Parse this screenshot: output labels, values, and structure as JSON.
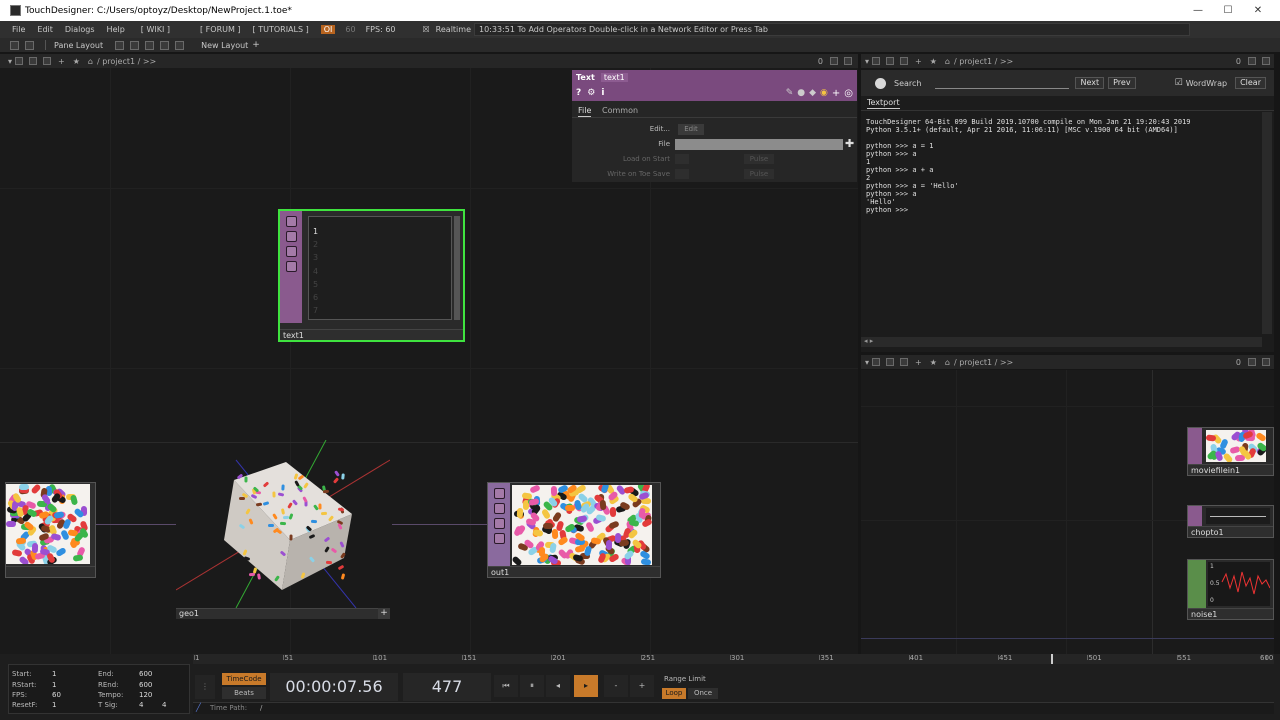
{
  "window": {
    "title": "TouchDesigner: C:/Users/optoyz/Desktop/NewProject.1.toe*",
    "minimize": "—",
    "maximize": "☐",
    "close": "✕"
  },
  "menubar": {
    "items": [
      "File",
      "Edit",
      "Dialogs",
      "Help"
    ],
    "wiki": "[ WIKI ]",
    "forum": "[ FORUM ]",
    "tutorials": "[ TUTORIALS ]",
    "oi_badge": "OI",
    "fps_cap": "60",
    "fps": "FPS: 60",
    "realtime_label": "Realtime",
    "status": "10:33:51 To Add Operators Double-click in a Network Editor or Press Tab"
  },
  "panebar": {
    "pane_layout": "Pane Layout",
    "new_layout": "New Layout"
  },
  "network_main": {
    "path": "/ project1 / >>",
    "zero": "0"
  },
  "nodes": {
    "text1": {
      "name": "text1",
      "lines": [
        "1",
        "2",
        "3",
        "4",
        "5",
        "6",
        "7"
      ]
    },
    "geo1": {
      "name": "geo1"
    },
    "out1": {
      "name": "out1"
    },
    "moviefilein1": {
      "name": "moviefilein1"
    },
    "chopto1": {
      "name": "chopto1"
    },
    "noise1": {
      "name": "noise1",
      "y_labels": [
        "1",
        "0.5",
        "0"
      ]
    }
  },
  "param": {
    "op_type": "Text",
    "op_name": "text1",
    "tabs": [
      "File",
      "Common"
    ],
    "edit_label": "Edit...",
    "edit_button": "Edit",
    "file_label": "File",
    "load_on_start": "Load on Start",
    "write_on_toe_save": "Write on Toe Save",
    "pulse": "Pulse"
  },
  "textport": {
    "search_label": "Search",
    "next": "Next",
    "prev": "Prev",
    "wordwrap": "WordWrap",
    "clear": "Clear",
    "tab": "Textport",
    "output": "TouchDesigner 64-Bit 099 Build 2019.10700 compile on Mon Jan 21 19:20:43 2019\nPython 3.5.1+ (default, Apr 21 2016, 11:06:11) [MSC v.1900 64 bit (AMD64)]\n\npython >>> a = 1\npython >>> a\n1\npython >>> a + a\n2\npython >>> a = 'Hello'\npython >>> a\n'Hello'\npython >>>"
  },
  "network_right": {
    "path": "/ project1 / >>",
    "zero": "0"
  },
  "timeline": {
    "start_lbl": "Start:",
    "start": "1",
    "end_lbl": "End:",
    "end": "600",
    "rstart_lbl": "RStart:",
    "rstart": "1",
    "rend_lbl": "REnd:",
    "rend": "600",
    "fps_lbl": "FPS:",
    "fps": "60",
    "tempo_lbl": "Tempo:",
    "tempo": "120",
    "resetf_lbl": "ResetF:",
    "resetf": "1",
    "tsig_lbl": "T Sig:",
    "tsig_a": "4",
    "tsig_b": "4",
    "timecode_btn": "TimeCode",
    "beats_btn": "Beats",
    "timecode": "00:00:07.56",
    "frame": "477",
    "range_limit": "Range Limit",
    "loop": "Loop",
    "once": "Once",
    "time_path_lbl": "Time Path:",
    "time_path": "/",
    "ruler": [
      "1",
      "51",
      "101",
      "151",
      "201",
      "251",
      "301",
      "351",
      "401",
      "451",
      "501",
      "551",
      "600"
    ]
  }
}
